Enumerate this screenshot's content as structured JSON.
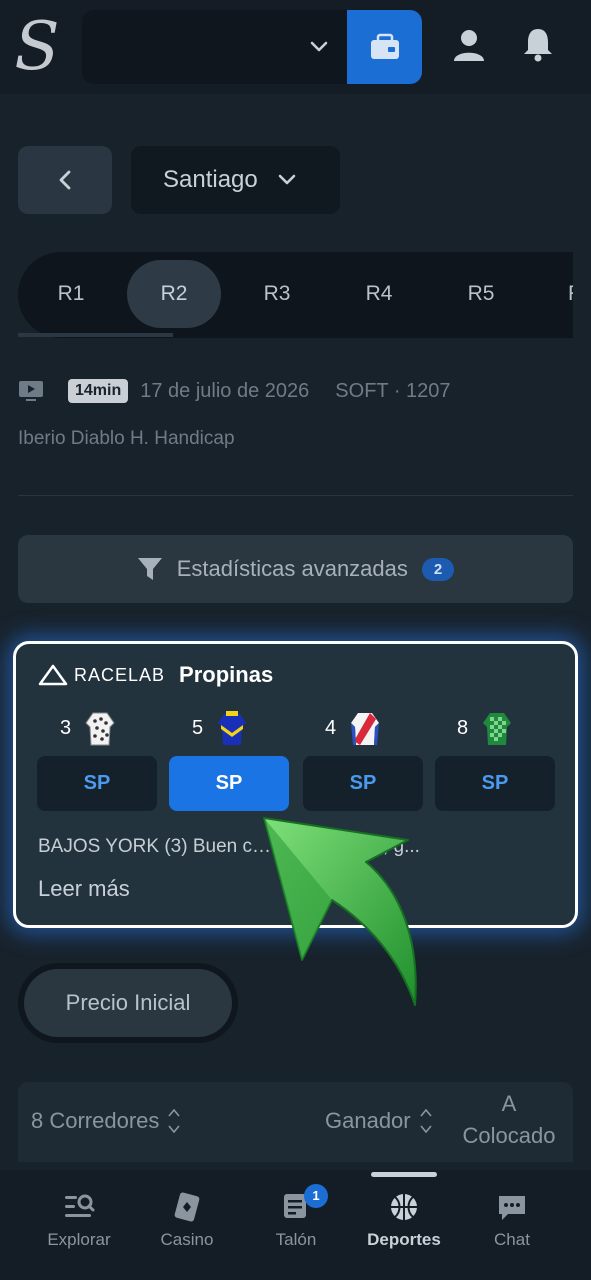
{
  "header": {
    "logo_text": "S",
    "balance_value": ""
  },
  "venue": {
    "name": "Santiago"
  },
  "race_tabs": [
    "R1",
    "R2",
    "R3",
    "R4",
    "R5",
    "R"
  ],
  "active_tab": "R2",
  "race_info": {
    "time_badge": "14min",
    "date": "17 de julio de 2026",
    "track": "SOFT · 1207",
    "name": "Iberio Diablo H. Handicap"
  },
  "stats": {
    "label": "Estadísticas avanzadas",
    "count": "2"
  },
  "tips": {
    "brand": "RACELAB",
    "title": "Propinas",
    "runners": [
      {
        "number": "3",
        "sp": "SP",
        "selected": false,
        "silk": "white-dots-icon"
      },
      {
        "number": "5",
        "sp": "SP",
        "selected": true,
        "silk": "blue-yellow-icon"
      },
      {
        "number": "4",
        "sp": "SP",
        "selected": false,
        "silk": "red-blue-sash-icon"
      },
      {
        "number": "8",
        "sp": "SP",
        "selected": false,
        "silk": "green-check-icon"
      }
    ],
    "text": "BAJOS YORK (3) Buen c…                on la carrera, g...",
    "read_more": "Leer más"
  },
  "price_button": "Precio Inicial",
  "runners_table": {
    "count_label": "8 Corredores",
    "winner_label": "Ganador",
    "place_label_1": "A",
    "place_label_2": "Colocado"
  },
  "nav": {
    "items": [
      {
        "label": "Explorar"
      },
      {
        "label": "Casino"
      },
      {
        "label": "Talón",
        "badge": "1"
      },
      {
        "label": "Deportes"
      },
      {
        "label": "Chat"
      }
    ]
  },
  "colors": {
    "accent": "#1b6ed4",
    "background": "#18222b",
    "arrow": "#3bb54a"
  }
}
